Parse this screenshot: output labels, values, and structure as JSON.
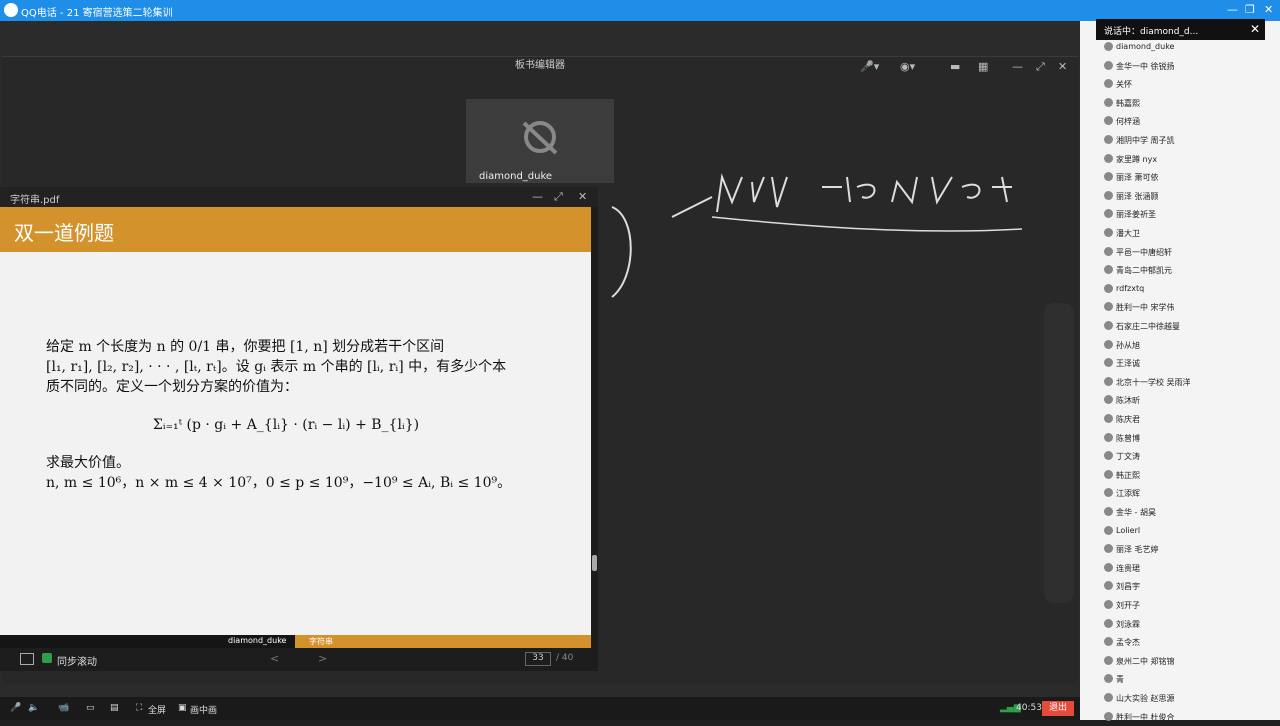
{
  "window": {
    "title": "QQ电话 - 21 寄宿营选策二轮集训",
    "controls": [
      "—",
      "❐",
      "✕"
    ]
  },
  "board": {
    "title": "板书编辑器"
  },
  "camera": {
    "user": "diamond_duke"
  },
  "pdf": {
    "filename": "字符串.pdf",
    "slide_title": "双一道例题",
    "line1": "给定 m 个长度为 n 的 0/1 串，你要把 [1, n] 划分成若干个区间",
    "line2": "[l₁, r₁], [l₂, r₂], · · · , [lₜ, rₜ]。设 gᵢ 表示 m 个串的 [lᵢ, rᵢ] 中，有多少个本",
    "line3": "质不同的。定义一个划分方案的价值为：",
    "formula": "Σᵢ₌₁ᵗ (p · gᵢ + A_{lᵢ} · (rᵢ − lᵢ) + B_{lᵢ})",
    "line4": "求最大价值。",
    "line5": "n, m ≤ 10⁶，n × m ≤ 4 × 10⁷，0 ≤ p ≤ 10⁹，−10⁹ ≤ Aᵢ, Bᵢ ≤ 10⁹。",
    "footer_author": "diamond_duke",
    "footer_topic": "字符串",
    "sync_label": "同步滚动",
    "page_current": "33",
    "page_total": "/ 40"
  },
  "speaking": {
    "text": "说话中：diamond_d..."
  },
  "members": [
    "diamond_duke",
    "金华一中 徐锐扬",
    "关怀",
    "韩嘉熙",
    "何梓涵",
    "湘阴中学 周子凯",
    "家里蹲 nyx",
    "丽泽 萧可依",
    "丽泽 张涵颢",
    "丽泽姜祈圣",
    "潘大卫",
    "平邑一中唐绍轩",
    "青岛二中郁凯元",
    "rdfzxtq",
    "胜利一中 宋学伟",
    "石家庄二中徐越曼",
    "孙从旭",
    "王泽诚",
    "北京十一学校 吴雨洋",
    "陈沐昕",
    "陈庆君",
    "陈曾博",
    "丁文涛",
    "韩正熙",
    "江添辉",
    "金华 - 胡昊",
    "Lolierl",
    "丽泽 毛艺婷",
    "连贵珺",
    "刘昌宇",
    "刘开子",
    "刘泳霖",
    "孟令杰",
    "泉州二中 郑铭锦",
    "青",
    "山大实验 赵思源",
    "胜利一中 杜俊合"
  ],
  "taskbar": {
    "fullscreen": "全屏",
    "pip": "画中画",
    "time": "40:53",
    "exit": "退出"
  }
}
